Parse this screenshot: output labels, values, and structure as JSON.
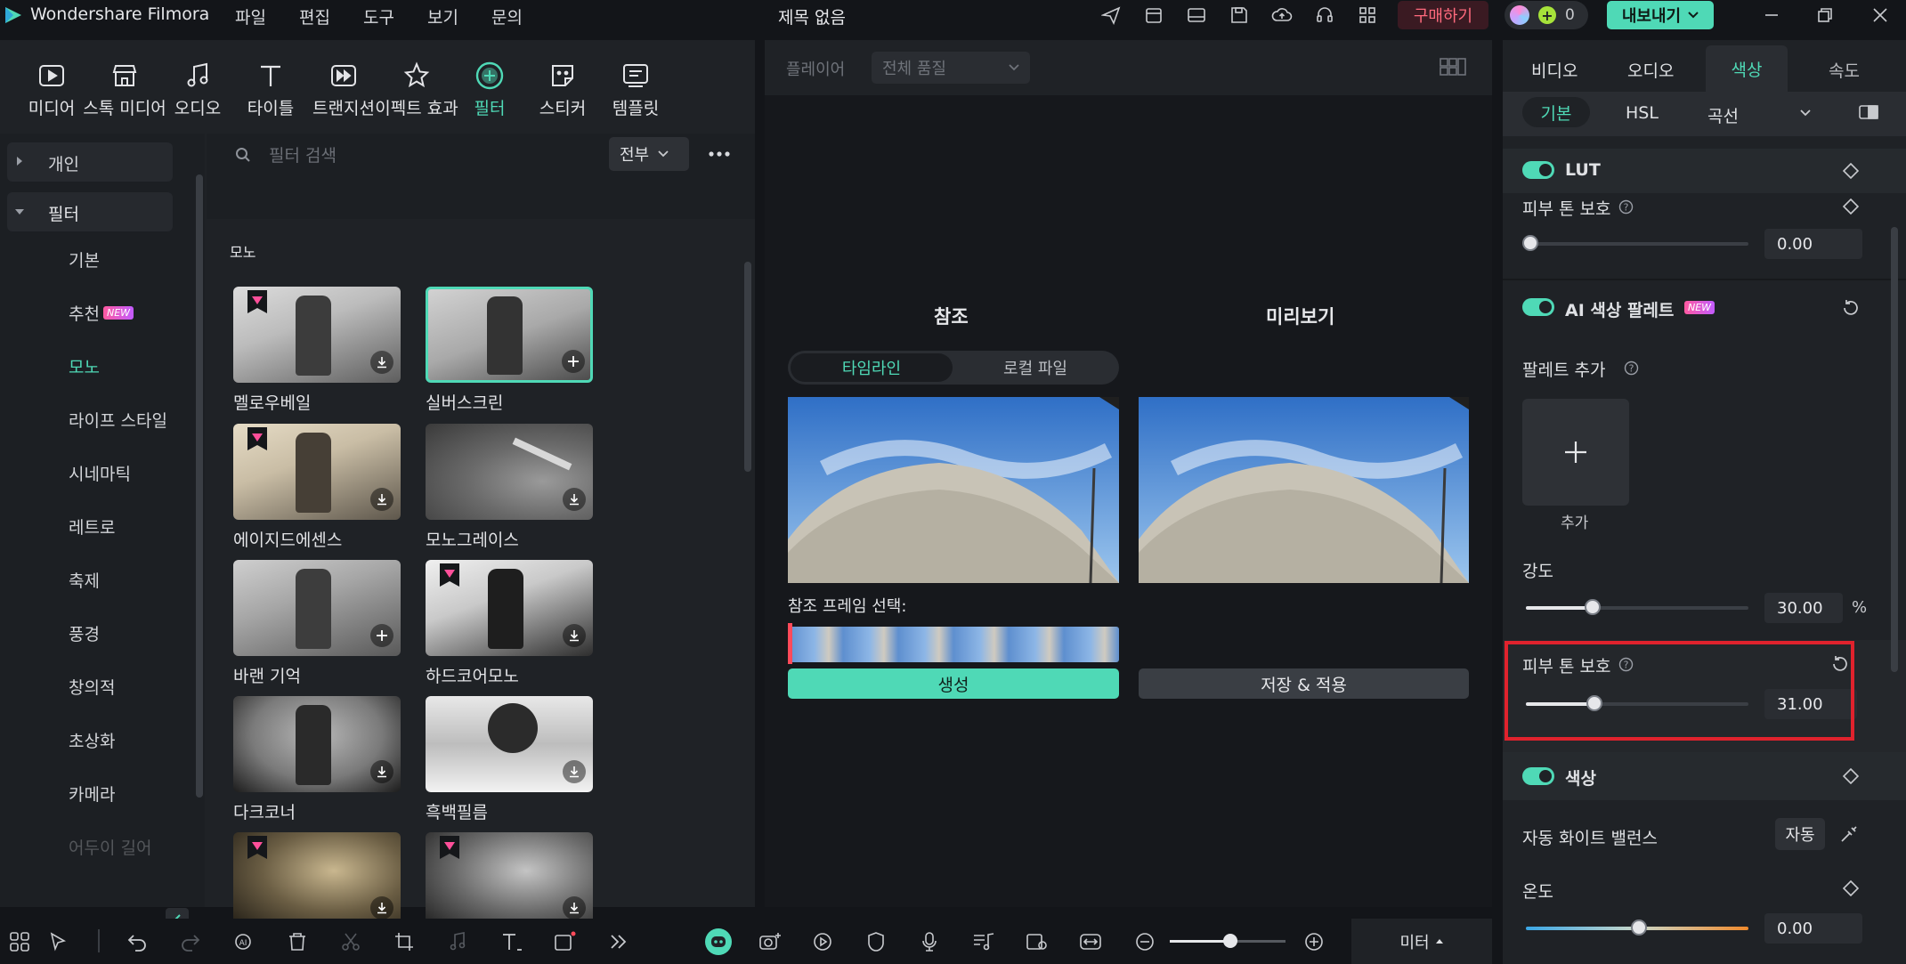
{
  "app": {
    "name": "Wondershare Filmora",
    "doc_title": "제목 없음"
  },
  "menu": [
    "파일",
    "편집",
    "도구",
    "보기",
    "문의"
  ],
  "titlebar": {
    "buy_label": "구매하기",
    "credits": "0",
    "export_label": "내보내기"
  },
  "toolbar": [
    "미디어",
    "스톡 미디어",
    "오디오",
    "타이틀",
    "트랜지션",
    "이펙트 효과",
    "필터",
    "스티커",
    "템플릿"
  ],
  "sidebar": {
    "groups": [
      {
        "label": "개인"
      },
      {
        "label": "필터"
      }
    ],
    "items": [
      "기본",
      "추천",
      "모노",
      "라이프 스타일",
      "시네마틱",
      "레트로",
      "축제",
      "풍경",
      "창의적",
      "초상화",
      "카메라",
      "어두이 길어"
    ],
    "new_badge": "NEW"
  },
  "search": {
    "placeholder": "필터 검색",
    "filter_label": "전부"
  },
  "grid": {
    "section": "모노",
    "items": [
      {
        "name": "멜로우베일"
      },
      {
        "name": "실버스크린"
      },
      {
        "name": "에이지드에센스"
      },
      {
        "name": "모노그레이스"
      },
      {
        "name": "바랜 기억"
      },
      {
        "name": "하드코어모노"
      },
      {
        "name": "다크코너"
      },
      {
        "name": "흑백필름"
      },
      {
        "name": ""
      },
      {
        "name": ""
      }
    ]
  },
  "player": {
    "label": "플레이어",
    "quality": "전체 품질",
    "ref_title": "참조",
    "preview_title": "미리보기",
    "tab_timeline": "타임라인",
    "tab_local": "로컬 파일",
    "frame_label": "참조 프레임 선택:",
    "generate": "생성",
    "save_apply": "저장 & 적용"
  },
  "right": {
    "tabs": [
      "비디오",
      "오디오",
      "색상",
      "속도"
    ],
    "subtabs": [
      "기본",
      "HSL",
      "곡선"
    ],
    "lut": "LUT",
    "skin_tone_1": "피부 톤 보호",
    "skin_tone_1_value": "0.00",
    "ai_palette": "AI 색상 팔레트",
    "new_badge": "NEW",
    "palette_add": "팔레트 추가",
    "add": "추가",
    "intensity": "강도",
    "intensity_value": "30.00",
    "percent": "%",
    "skin_tone_2": "피부 톤 보호",
    "skin_tone_2_value": "31.00",
    "color": "색상",
    "auto_wb": "자동 화이트 밸런스",
    "auto": "자동",
    "temperature": "온도",
    "temperature_value": "0.00"
  },
  "bottom": {
    "meter": "미터"
  },
  "colors": {
    "accent": "#4fd9b6",
    "highlight": "#e0222d",
    "buy": "#ff5a6e"
  }
}
